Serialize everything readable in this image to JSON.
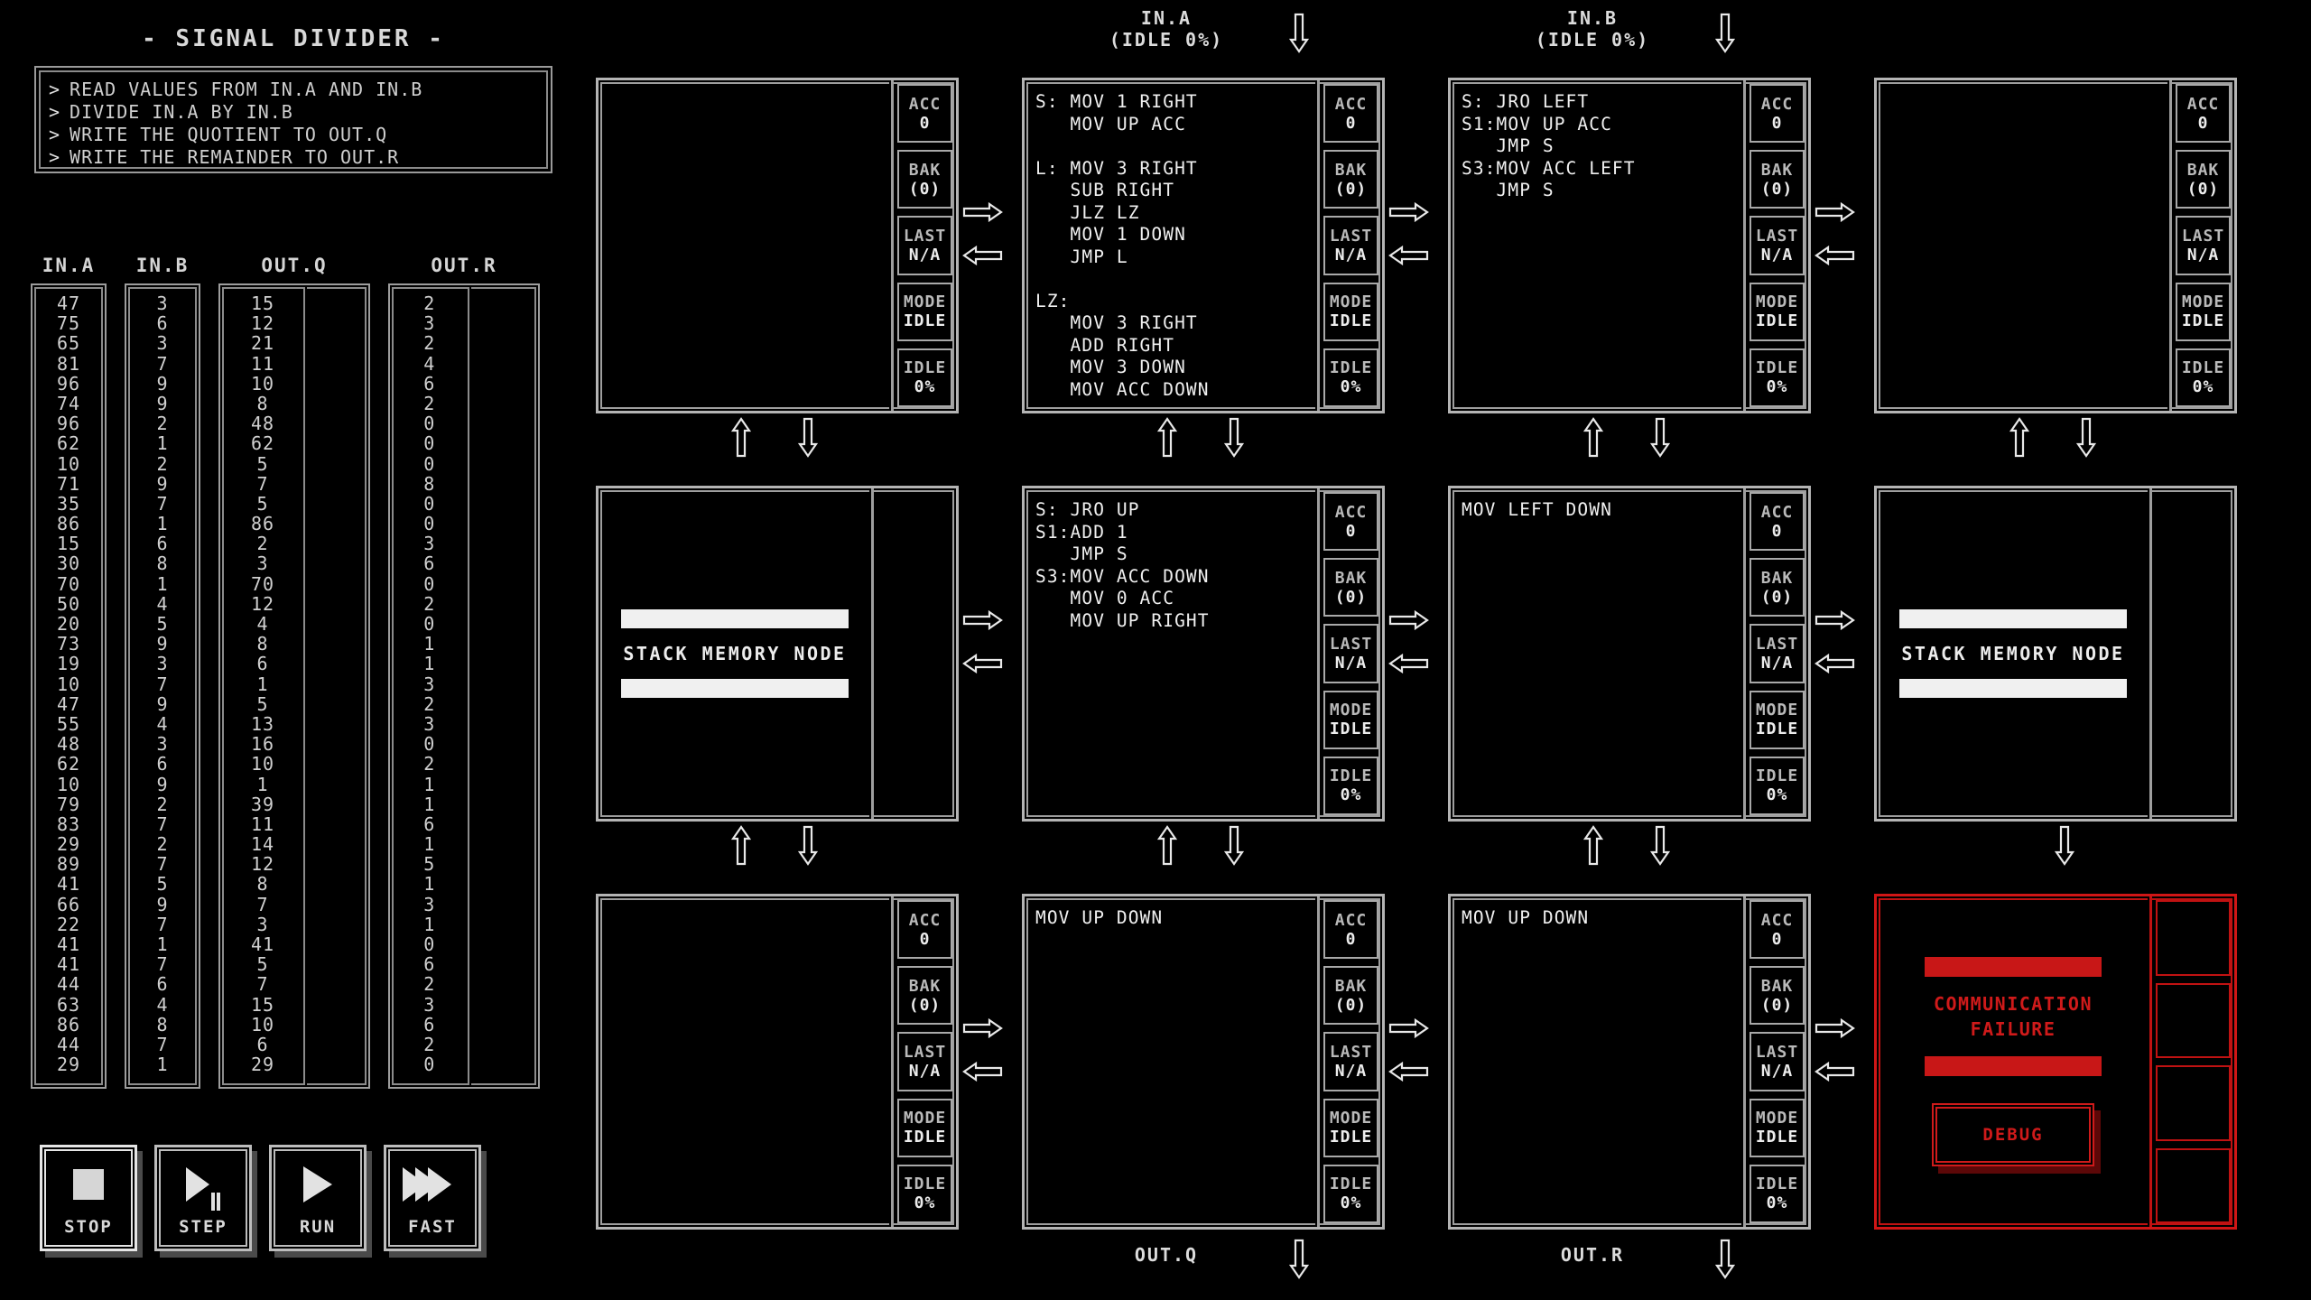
{
  "puzzle": {
    "title": "- SIGNAL DIVIDER -",
    "objectives": [
      "READ VALUES FROM IN.A AND IN.B",
      "DIVIDE IN.A BY IN.B",
      "WRITE THE QUOTIENT TO OUT.Q",
      "WRITE THE REMAINDER TO OUT.R"
    ],
    "bullet": ">"
  },
  "io": {
    "columns": [
      {
        "name": "IN.A",
        "kind": "input",
        "values": [
          47,
          75,
          65,
          81,
          96,
          74,
          96,
          62,
          10,
          71,
          35,
          86,
          15,
          30,
          70,
          50,
          20,
          73,
          19,
          10,
          47,
          55,
          48,
          62,
          10,
          79,
          83,
          29,
          89,
          41,
          66,
          22,
          41,
          41,
          44,
          63,
          86,
          44,
          29
        ]
      },
      {
        "name": "IN.B",
        "kind": "input",
        "values": [
          3,
          6,
          3,
          7,
          9,
          9,
          2,
          1,
          2,
          9,
          7,
          1,
          6,
          8,
          1,
          4,
          5,
          9,
          3,
          7,
          9,
          4,
          3,
          6,
          9,
          2,
          7,
          2,
          7,
          5,
          9,
          7,
          1,
          7,
          6,
          4,
          8,
          7,
          1
        ]
      },
      {
        "name": "OUT.Q",
        "kind": "output",
        "expected": [
          15,
          12,
          21,
          11,
          10,
          8,
          48,
          62,
          5,
          7,
          5,
          86,
          2,
          3,
          70,
          12,
          4,
          8,
          6,
          1,
          5,
          13,
          16,
          10,
          1,
          39,
          11,
          14,
          12,
          8,
          7,
          3,
          41,
          5,
          7,
          15,
          10,
          6,
          29
        ],
        "actual": []
      },
      {
        "name": "OUT.R",
        "kind": "output",
        "expected": [
          2,
          3,
          2,
          4,
          6,
          2,
          0,
          0,
          0,
          8,
          0,
          0,
          3,
          6,
          0,
          2,
          0,
          1,
          1,
          3,
          2,
          3,
          0,
          2,
          1,
          1,
          6,
          1,
          5,
          1,
          3,
          1,
          0,
          6,
          2,
          3,
          6,
          2,
          0
        ],
        "actual": []
      }
    ]
  },
  "controls": [
    {
      "label": "STOP",
      "icon": "stop-square-icon",
      "active": true
    },
    {
      "label": "STEP",
      "icon": "step-play-pause-icon",
      "active": false
    },
    {
      "label": "RUN",
      "icon": "play-icon",
      "active": false
    },
    {
      "label": "FAST",
      "icon": "fast-forward-icon",
      "active": false
    }
  ],
  "port_labels": {
    "top": [
      {
        "col": 1,
        "name": "IN.A",
        "status": "(IDLE 0%)"
      },
      {
        "col": 2,
        "name": "IN.B",
        "status": "(IDLE 0%)"
      }
    ],
    "bottom": [
      {
        "col": 1,
        "name": "OUT.Q"
      },
      {
        "col": 2,
        "name": "OUT.R"
      }
    ]
  },
  "registers": {
    "acc_name": "ACC",
    "acc_value": "0",
    "bak_name": "BAK",
    "bak_value": "(0)",
    "last_name": "LAST",
    "last_value": "N/A",
    "mode_name": "MODE",
    "mode_value": "IDLE",
    "idle_name": "IDLE",
    "idle_value": "0%"
  },
  "error_node": {
    "message_line1": "COMMUNICATION",
    "message_line2": "FAILURE",
    "debug_label": "DEBUG",
    "color": "#cf1a1a"
  },
  "stack_node_label": "STACK MEMORY NODE",
  "nodes": [
    {
      "id": "n0",
      "type": "compute",
      "code": []
    },
    {
      "id": "n1",
      "type": "compute",
      "code": [
        "S: MOV 1 RIGHT",
        "   MOV UP ACC",
        "",
        "L: MOV 3 RIGHT",
        "   SUB RIGHT",
        "   JLZ LZ",
        "   MOV 1 DOWN",
        "   JMP L",
        "",
        "LZ:",
        "   MOV 3 RIGHT",
        "   ADD RIGHT",
        "   MOV 3 DOWN",
        "   MOV ACC DOWN"
      ]
    },
    {
      "id": "n2",
      "type": "compute",
      "code": [
        "S: JRO LEFT",
        "S1:MOV UP ACC",
        "   JMP S",
        "S3:MOV ACC LEFT",
        "   JMP S"
      ]
    },
    {
      "id": "n3",
      "type": "compute",
      "code": []
    },
    {
      "id": "n4",
      "type": "stack",
      "code": []
    },
    {
      "id": "n5",
      "type": "compute",
      "code": [
        "S: JRO UP",
        "S1:ADD 1",
        "   JMP S",
        "S3:MOV ACC DOWN",
        "   MOV 0 ACC",
        "   MOV UP RIGHT"
      ]
    },
    {
      "id": "n6",
      "type": "compute",
      "code": [
        "MOV LEFT DOWN"
      ]
    },
    {
      "id": "n7",
      "type": "stack",
      "code": []
    },
    {
      "id": "n8",
      "type": "compute",
      "code": []
    },
    {
      "id": "n9",
      "type": "compute",
      "code": [
        "MOV UP DOWN"
      ]
    },
    {
      "id": "n10",
      "type": "compute",
      "code": [
        "MOV UP DOWN"
      ]
    },
    {
      "id": "n11",
      "type": "error",
      "code": []
    }
  ]
}
